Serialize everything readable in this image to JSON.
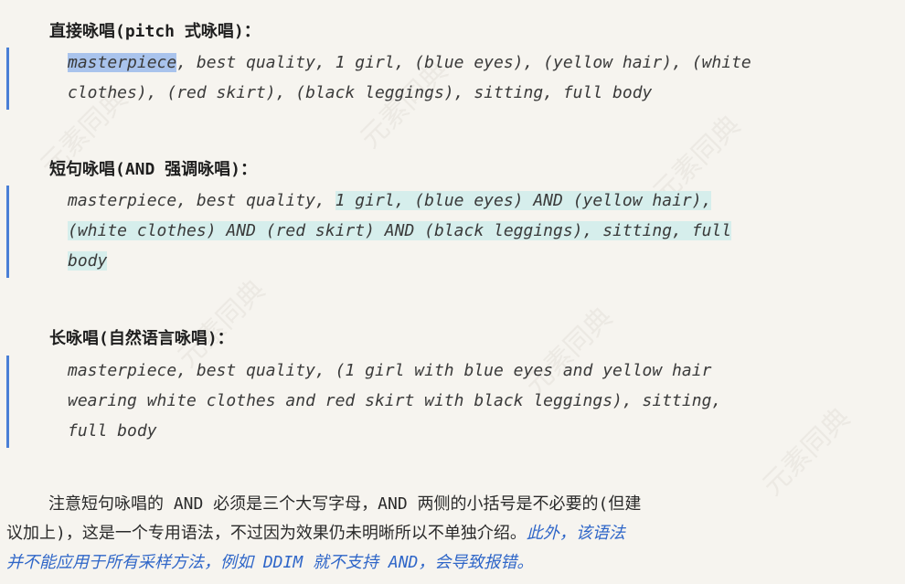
{
  "watermark_text": "元素同典",
  "sections": [
    {
      "heading": "直接咏唱(pitch 式咏唱)：",
      "lines": [
        {
          "selected": "masterpiece",
          "rest": ", best quality, 1 girl, (blue eyes), (yellow hair), (white"
        },
        {
          "text": "clothes), (red skirt), (black leggings), sitting, full body"
        }
      ]
    },
    {
      "heading": "短句咏唱(AND 强调咏唱)：",
      "lines": [
        {
          "plain": "masterpiece, best quality, ",
          "highlight": "1 girl, (blue eyes) AND (yellow hair),"
        },
        {
          "highlight": "(white clothes) AND (red skirt) AND (black leggings), sitting, full"
        },
        {
          "highlight": "body"
        }
      ]
    },
    {
      "heading": "长咏唱(自然语言咏唱)：",
      "lines": [
        {
          "text": "masterpiece, best quality, (1 girl with blue eyes and yellow hair"
        },
        {
          "text": "wearing white clothes and red skirt with black leggings), sitting,"
        },
        {
          "text": "full body"
        }
      ]
    }
  ],
  "note": {
    "line1": "注意短句咏唱的 AND 必须是三个大写字母，AND 两侧的小括号是不必要的(但建",
    "line2_plain": "议加上)，这是一个专用语法，不过因为效果仍未明晰所以不单独介绍。",
    "line2_italic": "此外，该语法",
    "line3_italic": "并不能应用于所有采样方法，例如 DDIM 就不支持 AND，会导致报错。"
  },
  "colors": {
    "quote_border": "#4a7fd6",
    "selection": "#a9c3ec",
    "highlight": "#d6eeec",
    "italic_link": "#2f66c8"
  }
}
